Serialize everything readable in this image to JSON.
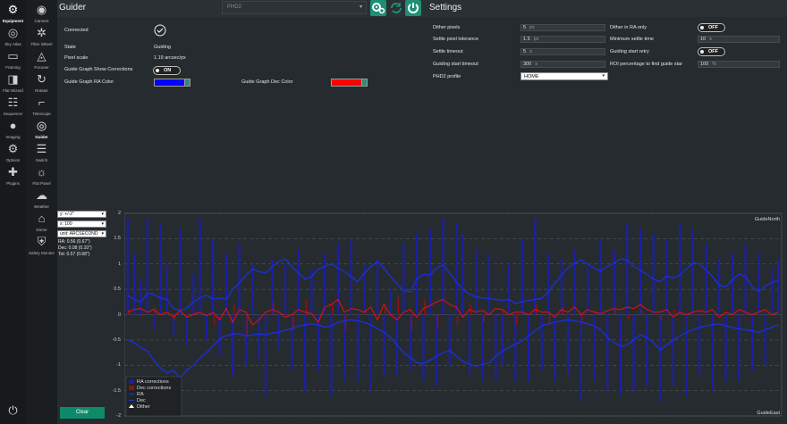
{
  "nav_primary": [
    {
      "label": "Equipment",
      "icon": "equipment-icon",
      "active": true
    },
    {
      "label": "Sky Atlas",
      "icon": "sky-atlas-icon"
    },
    {
      "label": "Framing",
      "icon": "framing-icon"
    },
    {
      "label": "Flat Wizard",
      "icon": "flat-wizard-icon"
    },
    {
      "label": "Sequencer",
      "icon": "sequencer-icon"
    },
    {
      "label": "Imaging",
      "icon": "imaging-icon"
    },
    {
      "label": "Options",
      "icon": "options-icon"
    },
    {
      "label": "Plugins",
      "icon": "plugins-icon"
    }
  ],
  "nav_equipment": [
    {
      "label": "Camera",
      "icon": "camera-icon"
    },
    {
      "label": "Filter Wheel",
      "icon": "filter-wheel-icon"
    },
    {
      "label": "Focuser",
      "icon": "focuser-icon"
    },
    {
      "label": "Rotator",
      "icon": "rotator-icon"
    },
    {
      "label": "Telescope",
      "icon": "telescope-icon"
    },
    {
      "label": "Guider",
      "icon": "guider-icon",
      "active": true
    },
    {
      "label": "Switch",
      "icon": "switch-icon"
    },
    {
      "label": "Flat Panel",
      "icon": "flat-panel-icon"
    },
    {
      "label": "Weather",
      "icon": "weather-icon"
    },
    {
      "label": "Dome",
      "icon": "dome-icon"
    },
    {
      "label": "Safety Monitor",
      "icon": "safety-monitor-icon"
    }
  ],
  "header": {
    "title": "Guider",
    "device": "PHD2",
    "settings_title": "Settings"
  },
  "guider": {
    "connected_label": "Connected",
    "state_label": "State",
    "state_value": "Guiding",
    "pixel_scale_label": "Pixel scale",
    "pixel_scale_value": "1.19 arcsec/px",
    "show_corrections_label": "Guide Graph Show Corrections",
    "show_corrections_value": "ON",
    "ra_color_label": "Guide Graph RA Color",
    "ra_color": "#0000ff",
    "dec_color_label": "Guide Graph Dec Color",
    "dec_color": "#ff0000"
  },
  "settings": {
    "dither_pixels_label": "Dither pixels",
    "dither_pixels_value": "5",
    "dither_pixels_unit": "px",
    "settle_tol_label": "Settle pixel tolerance",
    "settle_tol_value": "1.5",
    "settle_tol_unit": "px",
    "settle_timeout_label": "Settle timeout",
    "settle_timeout_value": "5",
    "settle_timeout_unit": "s",
    "guiding_start_timeout_label": "Guiding start timeout",
    "guiding_start_timeout_value": "300",
    "guiding_start_timeout_unit": "s",
    "profile_label": "PHD2 profile",
    "profile_value": "HOME",
    "dither_ra_only_label": "Dither in RA only",
    "dither_ra_only_value": "OFF",
    "min_settle_label": "Minimum settle time",
    "min_settle_value": "10",
    "min_settle_unit": "s",
    "retry_label": "Guiding start retry",
    "retry_value": "OFF",
    "roi_label": "ROI percentage to find guide star",
    "roi_value": "100",
    "roi_unit": "%"
  },
  "graph_controls": {
    "y_scale": "y: +/-2\"",
    "x_count": "x: 100",
    "unit": "unit: ARCSECOND",
    "ra_stat": "RA: 0.56 (0.67\")",
    "dec_stat": "Dec: 0.08 (0.10\")",
    "tot_stat": "Tot: 0.57 (0.68\")",
    "clear_label": "Clear"
  },
  "chart_data": {
    "type": "line",
    "ylim": [
      -2,
      2
    ],
    "yticks": [
      "2",
      "1.5",
      "1",
      "0.5",
      "0",
      "-0.5",
      "-1",
      "-1.5",
      "-2"
    ],
    "north_label": "GuideNorth",
    "east_label": "GuideEast",
    "legend": [
      "RA corrections",
      "Dec corrections",
      "RA",
      "Dec",
      "Dither"
    ],
    "colors": {
      "ra": "#1a2fd6",
      "dec": "#e01010",
      "ra_corr": "#1a1fa8",
      "dec_corr": "#8a1414"
    },
    "ra": [
      0.38,
      0.3,
      0.25,
      0.42,
      0.4,
      0.33,
      0.3,
      0.12,
      0.08,
      0.13,
      0.25,
      0.33,
      0.38,
      0.31,
      0.33,
      0.3,
      0.5,
      0.62,
      0.78,
      0.9,
      0.85,
      0.82,
      0.95,
      1.05,
      1.1,
      0.95,
      0.82,
      0.7,
      0.75,
      0.9,
      0.95,
      1.0,
      0.92,
      0.85,
      0.75,
      0.65,
      0.82,
      0.95,
      1.05,
      0.92,
      0.75,
      0.6,
      0.48,
      0.45,
      0.7,
      0.8,
      0.78,
      0.92,
      0.98,
      0.82,
      0.65,
      0.5,
      0.4,
      0.35,
      0.33,
      0.32,
      0.3,
      0.28,
      0.3,
      0.22,
      0.25,
      0.28,
      0.3,
      0.32,
      0.45,
      0.62,
      0.78,
      0.92,
      1.02,
      1.08,
      1.0,
      0.92,
      0.86,
      0.95,
      1.02,
      1.1,
      1.08,
      0.95,
      0.88,
      0.8,
      0.7,
      0.65,
      0.76,
      0.72,
      0.78,
      0.9,
      1.02,
      1.0,
      0.88,
      0.75,
      0.58,
      0.55,
      0.68,
      0.8,
      0.75,
      0.55,
      0.46,
      0.56,
      0.63,
      0.68
    ],
    "dec": [
      -0.5,
      -0.55,
      -0.65,
      -0.72,
      -0.9,
      -1.05,
      -1.15,
      -1.1,
      -1.25,
      -1.1,
      -1.0,
      -0.85,
      -0.75,
      -0.62,
      -0.48,
      -0.42,
      -0.38,
      -0.38,
      -0.42,
      -0.4,
      -0.38,
      -0.4,
      -0.36,
      -0.35,
      -0.3,
      -0.28,
      -0.22,
      -0.2,
      -0.18,
      -0.2,
      -0.25,
      -0.22,
      -0.15,
      -0.12,
      -0.1,
      -0.12,
      -0.15,
      -0.2,
      -0.28,
      -0.35,
      -0.45,
      -0.6,
      -0.75,
      -0.85,
      -0.95,
      -0.97,
      -0.9,
      -0.82,
      -0.75,
      -0.7,
      -0.82,
      -0.92,
      -0.98,
      -1.02,
      -0.98,
      -0.95,
      -0.82,
      -0.72,
      -0.65,
      -0.58,
      -0.52,
      -0.42,
      -0.32,
      -0.22,
      -0.18,
      -0.15,
      -0.12,
      -0.1,
      -0.12,
      -0.15,
      -0.18,
      -0.22,
      -0.3,
      -0.45,
      -0.55,
      -0.62,
      -0.6,
      -0.5,
      -0.4,
      -0.45,
      -0.55,
      -0.7,
      -0.6,
      -0.5,
      -0.42,
      -0.35,
      -0.3,
      -0.25,
      -0.22,
      -0.2,
      -0.18,
      -0.22,
      -0.25,
      -0.28,
      -0.3,
      -0.32,
      -0.35,
      -0.3,
      -0.25,
      -0.2
    ],
    "ra_corrections": [
      1.9,
      1.2,
      0.7,
      1.9,
      -0.3,
      1.8,
      1.0,
      -0.4,
      1.7,
      -0.6,
      0.8,
      1.9,
      -0.5,
      1.5,
      -0.8,
      1.2,
      -1.2,
      1.4,
      -1.0,
      1.0,
      -0.9,
      -1.6,
      1.1,
      -0.7,
      1.0,
      -1.1,
      1.3,
      -1.5,
      0.9,
      -1.1,
      1.2,
      -1.6,
      1.4,
      -1.3,
      1.5,
      -1.3,
      1.0,
      -1.5,
      1.1,
      -1.2,
      0.5,
      -1.2,
      1.4,
      -1.1,
      1.6,
      -1.3,
      1.7,
      -1.4,
      1.9,
      -1.0,
      1.8,
      1.6,
      -1.2,
      1.3,
      -1.3,
      1.2,
      -1.3,
      -1.0,
      1.0,
      -1.3,
      1.5,
      -1.3,
      1.9,
      -1.1,
      1.2,
      -1.3,
      1.1,
      -1.2,
      1.3,
      -1.7,
      1.0,
      -1.3,
      1.5,
      -1.5,
      1.3,
      -1.6,
      1.8,
      -1.5,
      1.7,
      -1.4,
      1.6,
      -1.7,
      1.5,
      -1.4,
      1.8,
      -1.6,
      1.7,
      -1.2,
      1.4,
      -1.5,
      1.1,
      -1.3,
      1.2,
      -1.3,
      1.4,
      -1.1,
      1.2,
      -1.0,
      0.9,
      1.1
    ],
    "dec_corrections": [
      0.1,
      0,
      -0.05,
      0,
      0.15,
      0,
      0,
      -0.1,
      0,
      0,
      0.05,
      0,
      0,
      -0.2,
      0,
      0,
      0.2,
      0,
      -0.4,
      0,
      0,
      0,
      0.25,
      0,
      0,
      -0.3,
      0,
      0.3,
      0,
      0,
      0,
      0.2,
      0,
      -0.3,
      0,
      0,
      0.1,
      0,
      0,
      0.2,
      0,
      0.35,
      0,
      -0.3,
      0,
      0.3,
      0,
      -0.25,
      0,
      0,
      -0.2,
      0,
      0.2,
      0,
      -0.15,
      0,
      0,
      0.1,
      0,
      -0.2,
      0,
      0,
      0.2,
      0,
      -0.2,
      0,
      0.15,
      0,
      0,
      -0.15,
      0,
      0.1,
      0,
      0,
      0.1,
      0,
      -0.1,
      0,
      0.1,
      0,
      0,
      -0.1,
      0,
      0.1,
      0,
      0,
      0,
      0.05,
      0,
      0,
      0,
      0,
      0,
      0,
      0.05,
      0,
      0,
      0,
      0,
      0
    ],
    "ra_line": [
      0.05,
      0.1,
      0.12,
      0.05,
      0.1,
      0.0,
      0.05,
      -0.05,
      0.08,
      -0.05,
      0.0,
      0.05,
      -0.02,
      0.05,
      -0.1,
      0.12,
      -0.15,
      0.1,
      0.05,
      -0.2,
      -0.1,
      0.05,
      0.1,
      0.05,
      -0.05,
      0.0,
      0.1,
      0.05,
      0.02,
      -0.15,
      0.15,
      0.2,
      0.3,
      0.05,
      0.12,
      0.1,
      0.05,
      0.15,
      -0.1,
      0.2,
      0.0,
      -0.1,
      0.05,
      0.1,
      -0.05,
      0.12,
      0.18,
      0.25,
      0.3,
      0.2,
      0.15,
      -0.05,
      0.1,
      0.05,
      0.08,
      0.0,
      0.12,
      0.1,
      0.0,
      0.05,
      0.05,
      0.0,
      0.1,
      0.05,
      0.05,
      -0.05,
      0.1,
      0.05,
      0.15,
      0.0,
      0.1,
      0.05,
      0.02,
      0.08,
      0.12,
      0.1,
      0.15,
      0.12,
      0.2,
      0.1,
      0.05,
      0.05,
      0.1,
      -0.05,
      0.05,
      0.0,
      0.05,
      0.08,
      0.05,
      0.1,
      -0.05,
      0.05,
      0.0,
      0.1,
      0.05,
      0.0,
      0.05,
      0.1,
      0.0,
      0.05
    ]
  }
}
